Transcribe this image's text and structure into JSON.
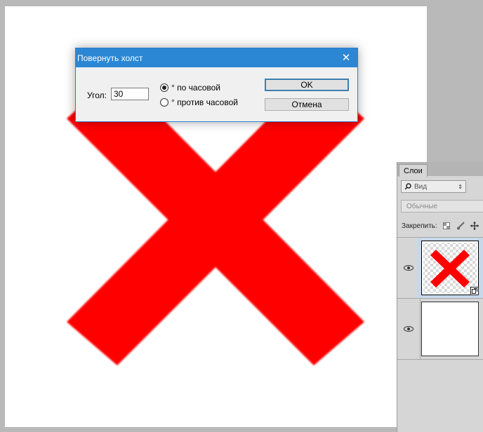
{
  "dialog": {
    "title": "Повернуть холст",
    "close_glyph": "✕",
    "angle_label": "Угол:",
    "angle_value": "30",
    "clockwise_label": "° по часовой",
    "counterclockwise_label": "° против часовой",
    "selected_direction": "clockwise",
    "ok_label": "OK",
    "cancel_label": "Отмена"
  },
  "canvas": {
    "shape_color": "#ff0000",
    "background": "#ffffff"
  },
  "layers_panel": {
    "tab_label": "Слои",
    "filter_label": "Вид",
    "filter_icon": "search-icon",
    "blend_mode": "Обычные",
    "lock_label": "Закрепить:",
    "lock_icons": [
      "lock-transparent-icon",
      "lock-brush-icon",
      "lock-move-icon"
    ],
    "layers": [
      {
        "name": "x-shape-layer",
        "visible": true,
        "selected": true,
        "smart_object": true
      },
      {
        "name": "background-layer",
        "visible": true,
        "selected": false,
        "smart_object": false
      }
    ]
  }
}
